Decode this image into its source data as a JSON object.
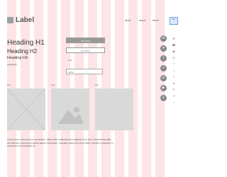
{
  "header": {
    "logo_text": "Label",
    "nav": [
      "Item1",
      "about",
      "Item3"
    ],
    "lang_label": "En"
  },
  "headings": {
    "h1": "Heading H1",
    "h2": "Heading H2",
    "h3": "Heading H3",
    "paragraph": "paragraph"
  },
  "buttons": {
    "primary": "BUTTON",
    "secondary": "BUTTON"
  },
  "link_text": "Link",
  "input": {
    "value": "name"
  },
  "image_labels": [
    "img",
    "img",
    "img"
  ],
  "lorem": "Lorem ipsum dolor sit amet consectetur. Vitae auctor pharetra eget feugiat ac id ut risus. Suspendisse diam orci nibh arcu. Sed varius auctor aliquet consectetur. Vulputate sapien orci id id mattis. Suscipit consectetur in elementum ipsum facilisis ac.",
  "social_icons": [
    "chat-icon",
    "send-icon",
    "twitter-icon",
    "telegram-icon",
    "whatsapp-icon",
    "youtube-icon",
    "vk-icon"
  ],
  "side_icons": [
    "mail-icon",
    "phone-icon",
    "location-icon",
    "clock-icon",
    "heart-icon",
    "star-icon",
    "share-icon",
    "pin-icon",
    "edit-icon",
    "arrow-icon",
    "plus-icon"
  ]
}
